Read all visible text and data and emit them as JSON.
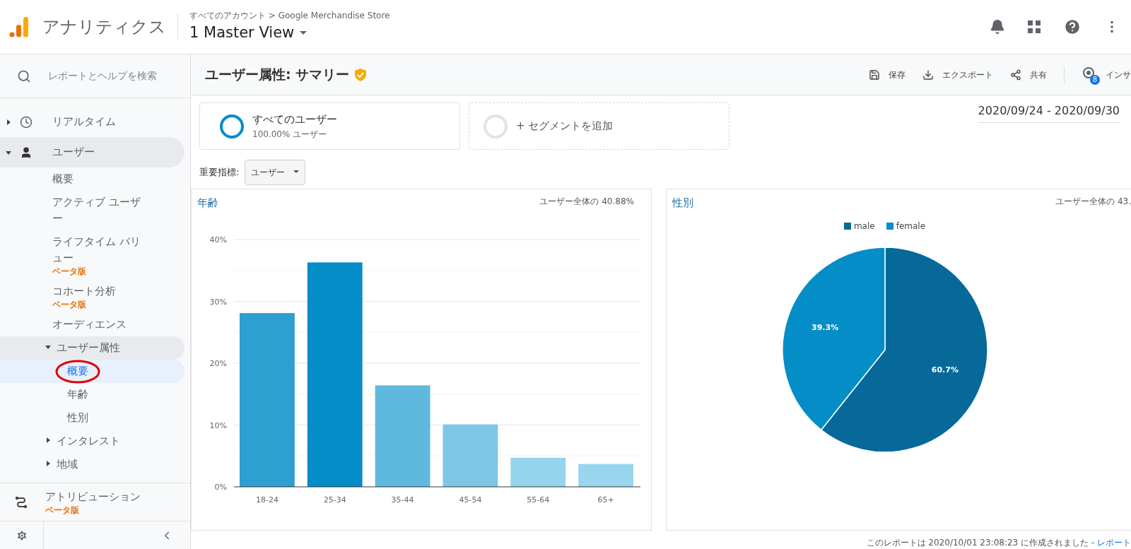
{
  "header": {
    "product": "アナリティクス",
    "breadcrumb": "すべてのアカウント > Google Merchandise Store",
    "view": "1 Master View"
  },
  "sidebar": {
    "search_placeholder": "レポートとヘルプを検索",
    "items": [
      {
        "label": "リアルタイム",
        "expanded": false
      },
      {
        "label": "ユーザー",
        "expanded": true,
        "children": [
          {
            "label": "概要",
            "selected": false
          },
          {
            "label": "アクティブ ユーザー",
            "selected": false
          },
          {
            "label": "ライフタイム バリュー",
            "badge": "ベータ版",
            "selected": false
          },
          {
            "label": "コホート分析",
            "badge": "ベータ版",
            "selected": false
          },
          {
            "label": "オーディエンス",
            "selected": false
          },
          {
            "label": "ユーザー属性",
            "expanded": true,
            "children": [
              {
                "label": "概要",
                "selected": true
              },
              {
                "label": "年齢",
                "selected": false
              },
              {
                "label": "性別",
                "selected": false
              }
            ]
          },
          {
            "label": "インタレスト",
            "expanded": false
          },
          {
            "label": "地域",
            "expanded": false
          }
        ]
      }
    ],
    "bottom": {
      "label": "アトリビューション",
      "badge": "ベータ版"
    }
  },
  "page": {
    "title": "ユーザー属性: サマリー",
    "actions": [
      "保存",
      "エクスポート",
      "共有"
    ],
    "insights": {
      "label": "インサ",
      "count": "8"
    },
    "date_range": "2020/09/24 - 2020/09/30"
  },
  "segments": [
    {
      "kind": "active",
      "name": "すべてのユーザー",
      "detail": "100.00% ユーザー"
    },
    {
      "kind": "add",
      "name": "+ セグメントを追加"
    }
  ],
  "metric": {
    "label": "重要指標:",
    "value": "ユーザー"
  },
  "age": {
    "title": "年齢",
    "share": "ユーザー全体の 40.88%",
    "chart_data": {
      "type": "bar",
      "categories": [
        "18-24",
        "25-34",
        "35-44",
        "45-54",
        "55-64",
        "65+"
      ],
      "series": [
        {
          "values": [
            28.1,
            36.3,
            16.4,
            10.1,
            4.7,
            3.7
          ]
        }
      ],
      "colors": [
        "#2d9fd0",
        "#058dc7",
        "#5fb8de",
        "#7ec6e6",
        "#96d3ec",
        "#9ad5ee"
      ],
      "grid": true,
      "ylim": [
        0,
        40
      ],
      "yticks": [
        {
          "value": 0,
          "label": "0%"
        },
        {
          "value": 10,
          "label": "10%"
        },
        {
          "value": 20,
          "label": "20%"
        },
        {
          "value": 30,
          "label": "30%"
        },
        {
          "value": 40,
          "label": "40%"
        }
      ]
    }
  },
  "gender": {
    "title": "性別",
    "share": "ユーザー全体の 43.",
    "chart_data": {
      "type": "pie",
      "categories": [
        "male",
        "female"
      ],
      "series": [
        {
          "values": [
            60.7,
            39.3
          ]
        }
      ],
      "colors": [
        "#06699a",
        "#058dc7"
      ],
      "value_labels": [
        "60.7%",
        "39.3%"
      ]
    }
  },
  "footer": {
    "text": "このレポートは 2020/10/01 23:08:23 に作成されました - ",
    "link": "レポート"
  }
}
